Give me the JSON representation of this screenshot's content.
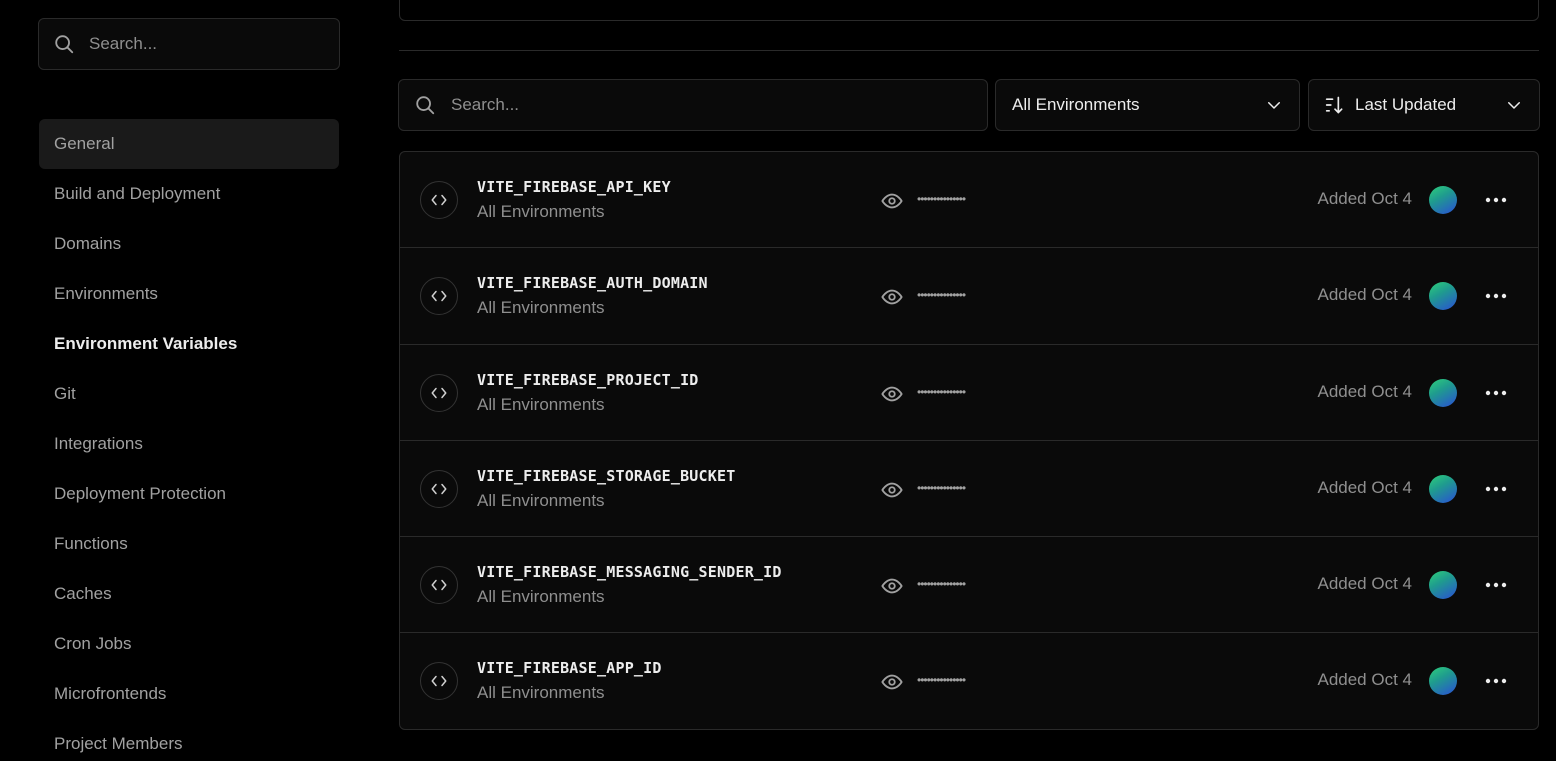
{
  "sidebar": {
    "search_placeholder": "Search...",
    "items": [
      {
        "label": "General"
      },
      {
        "label": "Build and Deployment"
      },
      {
        "label": "Domains"
      },
      {
        "label": "Environments"
      },
      {
        "label": "Environment Variables"
      },
      {
        "label": "Git"
      },
      {
        "label": "Integrations"
      },
      {
        "label": "Deployment Protection"
      },
      {
        "label": "Functions"
      },
      {
        "label": "Caches"
      },
      {
        "label": "Cron Jobs"
      },
      {
        "label": "Microfrontends"
      },
      {
        "label": "Project Members"
      }
    ]
  },
  "filters": {
    "search_placeholder": "Search...",
    "environment_selected": "All Environments",
    "sort_selected": "Last Updated"
  },
  "variables": [
    {
      "name": "VITE_FIREBASE_API_KEY",
      "environment": "All Environments",
      "masked_value": "•••••••••••••••",
      "added": "Added Oct 4"
    },
    {
      "name": "VITE_FIREBASE_AUTH_DOMAIN",
      "environment": "All Environments",
      "masked_value": "•••••••••••••••",
      "added": "Added Oct 4"
    },
    {
      "name": "VITE_FIREBASE_PROJECT_ID",
      "environment": "All Environments",
      "masked_value": "•••••••••••••••",
      "added": "Added Oct 4"
    },
    {
      "name": "VITE_FIREBASE_STORAGE_BUCKET",
      "environment": "All Environments",
      "masked_value": "•••••••••••••••",
      "added": "Added Oct 4"
    },
    {
      "name": "VITE_FIREBASE_MESSAGING_SENDER_ID",
      "environment": "All Environments",
      "masked_value": "•••••••••••••••",
      "added": "Added Oct 4"
    },
    {
      "name": "VITE_FIREBASE_APP_ID",
      "environment": "All Environments",
      "masked_value": "•••••••••••••••",
      "added": "Added Oct 4"
    }
  ],
  "icons": {
    "search": "search-icon",
    "chevron": "chevron-down-icon",
    "sort": "sort-icon",
    "code": "code-icon",
    "eye": "eye-icon",
    "more": "more-horizontal-icon"
  },
  "colors": {
    "background": "#000000",
    "surface": "#0a0a0a",
    "border": "#2a2a2a",
    "text": "#ededed",
    "muted": "#8f8f8f"
  }
}
